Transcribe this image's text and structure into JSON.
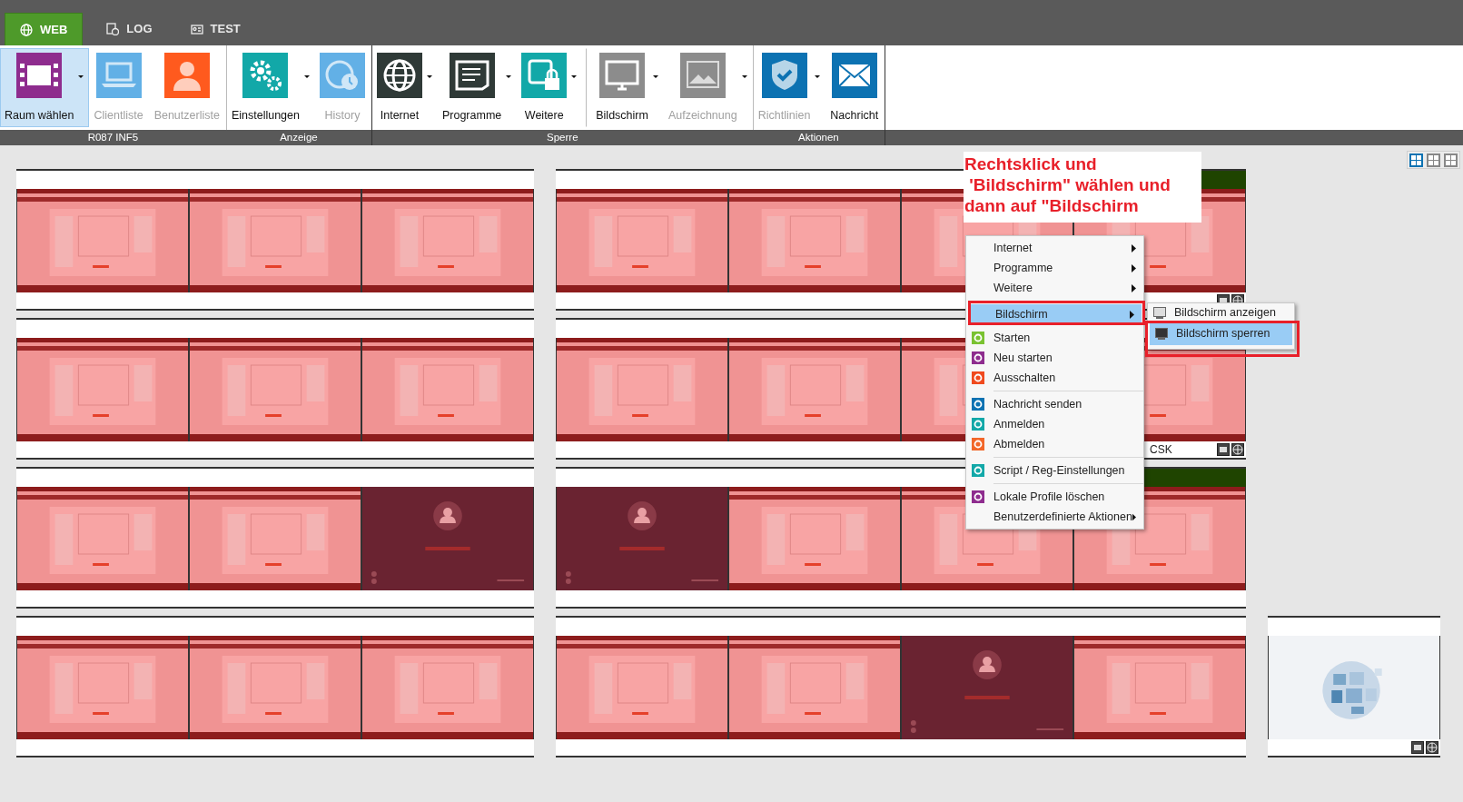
{
  "tabs": [
    {
      "label": "WEB",
      "selected": true
    },
    {
      "label": "LOG",
      "selected": false
    },
    {
      "label": "TEST",
      "selected": false
    }
  ],
  "ribbon": {
    "sections": [
      {
        "groups": [
          {
            "caption": "R087 INF5",
            "buttons": [
              {
                "label": "Raum wählen",
                "color": "#8e2c8e",
                "selected": true,
                "disabled": false,
                "dropdown": true,
                "separator_before": false
              },
              {
                "label": "Clientliste",
                "color": "#62b0e6",
                "selected": false,
                "disabled": true,
                "dropdown": false,
                "separator_before": false
              },
              {
                "label": "Benutzerliste",
                "color": "#ff5a1e",
                "selected": false,
                "disabled": true,
                "dropdown": false,
                "separator_before": false
              }
            ]
          },
          {
            "caption": "Anzeige",
            "buttons": [
              {
                "label": "Einstellungen",
                "color": "#12a8a8",
                "selected": false,
                "disabled": false,
                "dropdown": true,
                "separator_before": false
              },
              {
                "label": "History",
                "color": "#62b0e6",
                "selected": false,
                "disabled": true,
                "dropdown": false,
                "separator_before": false
              }
            ]
          }
        ]
      },
      {
        "groups": [
          {
            "caption": "Sperre",
            "buttons": [
              {
                "label": "Internet",
                "color": "#2f3a37",
                "selected": false,
                "disabled": false,
                "dropdown": true,
                "separator_before": false
              },
              {
                "label": "Programme",
                "color": "#2f3a37",
                "selected": false,
                "disabled": false,
                "dropdown": true,
                "separator_before": false
              },
              {
                "label": "Weitere",
                "color": "#12a8a8",
                "selected": false,
                "disabled": false,
                "dropdown": true,
                "separator_before": false
              },
              {
                "label": "Bildschirm",
                "color": "#8c8c8c",
                "selected": false,
                "disabled": false,
                "dropdown": true,
                "separator_before": true
              },
              {
                "label": "Aufzeichnung",
                "color": "#8c8c8c",
                "selected": false,
                "disabled": true,
                "dropdown": true,
                "separator_before": false
              }
            ]
          },
          {
            "caption": "Aktionen",
            "buttons": [
              {
                "label": "Richtlinien",
                "color": "#0c72b2",
                "selected": false,
                "disabled": true,
                "dropdown": true,
                "separator_before": false
              },
              {
                "label": "Nachricht",
                "color": "#0c72b2",
                "selected": false,
                "disabled": false,
                "dropdown": false,
                "separator_before": false
              }
            ]
          }
        ]
      }
    ]
  },
  "view_modes": [
    {
      "selected": true
    },
    {
      "selected": false
    },
    {
      "selected": false
    }
  ],
  "client_rows": [
    {
      "groups": [
        {
          "clients": [
            {
              "status_icons": false
            },
            {
              "status_icons": false
            },
            {
              "status_icons": false
            }
          ]
        },
        {
          "clients": [
            {
              "status_icons": false
            },
            {
              "status_icons": false
            },
            {
              "status_icons": false
            },
            {
              "color": "#1f4400",
              "status_icons": true
            }
          ]
        }
      ]
    },
    {
      "groups": [
        {
          "clients": [
            {
              "status_icons": false
            },
            {
              "status_icons": false
            },
            {
              "status_icons": false
            }
          ]
        },
        {
          "clients": [
            {
              "status_icons": false
            },
            {
              "status_icons": false
            },
            {
              "status_icons": false
            },
            {
              "status_icons": true,
              "label": "CSK"
            }
          ]
        }
      ]
    },
    {
      "groups": [
        {
          "clients": [
            {
              "status_icons": false
            },
            {
              "status_icons": false
            },
            {
              "status_icons": false
            }
          ]
        },
        {
          "clients": [
            {
              "status_icons": false
            },
            {
              "status_icons": false
            },
            {
              "status_icons": false
            },
            {
              "color": "#1f4400",
              "status_icons": false
            }
          ]
        }
      ]
    },
    {
      "groups": [
        {
          "clients": [
            {
              "status_icons": false
            },
            {
              "status_icons": false
            },
            {
              "status_icons": false
            }
          ]
        },
        {
          "clients": [
            {
              "status_icons": false
            },
            {
              "status_icons": false
            },
            {
              "status_icons": false
            },
            {
              "status_icons": false
            }
          ]
        },
        {
          "clients": [
            {
              "status_icons": true
            }
          ]
        }
      ]
    }
  ],
  "annotation": {
    "text": "Rechtsklick und\n 'Bildschirm\" wählen und\ndann auf \"Bildschirm"
  },
  "context_menu": {
    "items": [
      {
        "kind": "item",
        "label": "Internet",
        "submenu": true,
        "selected": false
      },
      {
        "kind": "item",
        "label": "Programme",
        "submenu": true,
        "selected": false
      },
      {
        "kind": "item",
        "label": "Weitere",
        "submenu": true,
        "selected": false
      },
      {
        "kind": "separator"
      },
      {
        "kind": "item",
        "label": "Bildschirm",
        "submenu": true,
        "selected": true
      },
      {
        "kind": "item",
        "label": "Starten",
        "submenu": false,
        "selected": false,
        "color": "#7ac231"
      },
      {
        "kind": "item",
        "label": "Neu starten",
        "submenu": false,
        "selected": false,
        "color": "#8e2c8e"
      },
      {
        "kind": "item",
        "label": "Ausschalten",
        "submenu": false,
        "selected": false,
        "color": "#f04a1e"
      },
      {
        "kind": "separator"
      },
      {
        "kind": "item",
        "label": "Nachricht senden",
        "submenu": false,
        "selected": false,
        "color": "#0c72b2"
      },
      {
        "kind": "item",
        "label": "Anmelden",
        "submenu": false,
        "selected": false,
        "color": "#12a8a8"
      },
      {
        "kind": "item",
        "label": "Abmelden",
        "submenu": false,
        "selected": false,
        "color": "#f2672a"
      },
      {
        "kind": "separator"
      },
      {
        "kind": "item",
        "label": "Script / Reg-Einstellungen",
        "submenu": false,
        "selected": false,
        "color": "#12a8a8"
      },
      {
        "kind": "separator"
      },
      {
        "kind": "item",
        "label": "Lokale Profile löschen",
        "submenu": false,
        "selected": false,
        "color": "#8e2c8e"
      },
      {
        "kind": "item",
        "label": "Benutzerdefinierte Aktionen",
        "submenu": true,
        "selected": false
      }
    ]
  },
  "submenu": {
    "items": [
      {
        "label": "Bildschirm anzeigen",
        "selected": false
      },
      {
        "label": "Bildschirm sperren",
        "selected": true
      }
    ]
  }
}
